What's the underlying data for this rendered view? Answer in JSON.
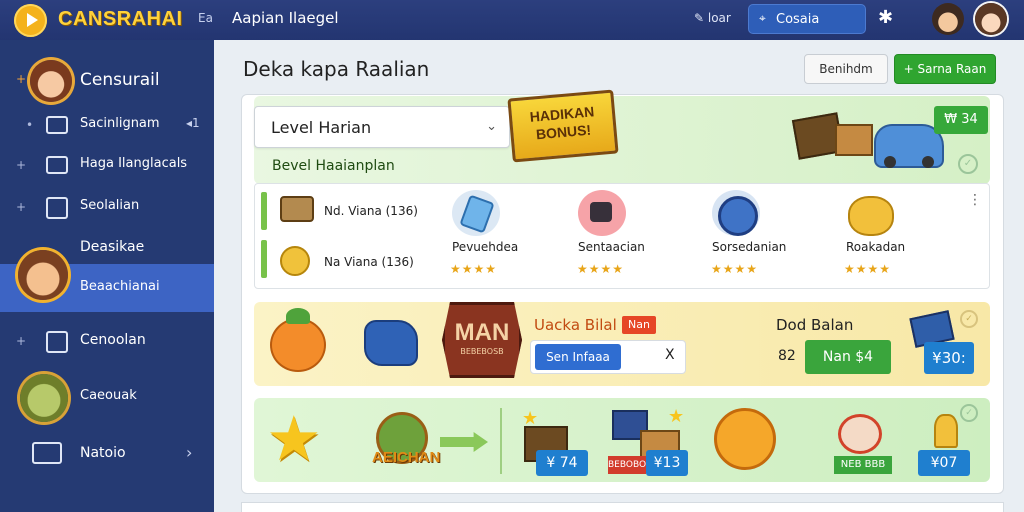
{
  "header": {
    "brand": "CANSRAHAI",
    "code": "Ea",
    "crumb": "Aapian Ilaegel",
    "mini_nav": "✎ loar",
    "search_label": "Cosaia",
    "colors": {
      "bar": "#2c3f7e",
      "brand": "#ffd23a",
      "search": "#2e5eb8"
    }
  },
  "sidebar": {
    "items": [
      {
        "label": "Censurail",
        "icon": "avatar-icon"
      },
      {
        "label": "Sacinlignam",
        "icon": "window-icon",
        "suffix": "◂1"
      },
      {
        "label": "Haga Ilanglacals",
        "icon": "window-icon"
      },
      {
        "label": "Seolalian",
        "icon": "package-icon"
      },
      {
        "label": "Deasikae",
        "icon": ""
      },
      {
        "label": "Beaachianai",
        "icon": "avatar-icon",
        "active": true
      },
      {
        "label": "Cenoolan",
        "icon": "package-icon"
      },
      {
        "label": "Caeouak",
        "icon": "avatar-icon"
      },
      {
        "label": "Natoio",
        "icon": "mail-icon"
      }
    ],
    "active_color": "#3d64c4"
  },
  "main": {
    "title": "Deka kapa Raalian",
    "btn_default": "Benihdm",
    "btn_primary": "+ Sarna Raan",
    "level_select": "Level Harian",
    "bonus_line1": "HADIKAN",
    "bonus_line2": "BONUS!",
    "price_top": "₩ 34",
    "section_title": "Bevel Haaianplan",
    "mini_items": [
      {
        "label": "Nd. Viana  (136)"
      },
      {
        "label": "Na Viana  (136)"
      }
    ],
    "items": [
      {
        "name": "Pevuehdea",
        "stars": "★★★★"
      },
      {
        "name": "Sentaacian",
        "stars": "★★★★"
      },
      {
        "name": "Sorsedanian",
        "stars": "★★★★"
      },
      {
        "name": "Roakadan",
        "stars": "★★★★"
      }
    ]
  },
  "promo1": {
    "badge_big": "MAN",
    "badge_small": "BEBEBOSB",
    "label": "Uacka Bilal",
    "tag": "Nan",
    "input_button": "Sen Infaaa",
    "input_x": "X",
    "deal_title": "Dod Balan",
    "deal_num": "82",
    "buy_label": "Nan $4",
    "price": "¥30:"
  },
  "promo2": {
    "bazaar": "AEICHAN",
    "price1": "¥ 74",
    "price2": "¥13",
    "price3": "¥07",
    "red_label": "BEBOBOBB",
    "green_label": "NEB BBB"
  }
}
